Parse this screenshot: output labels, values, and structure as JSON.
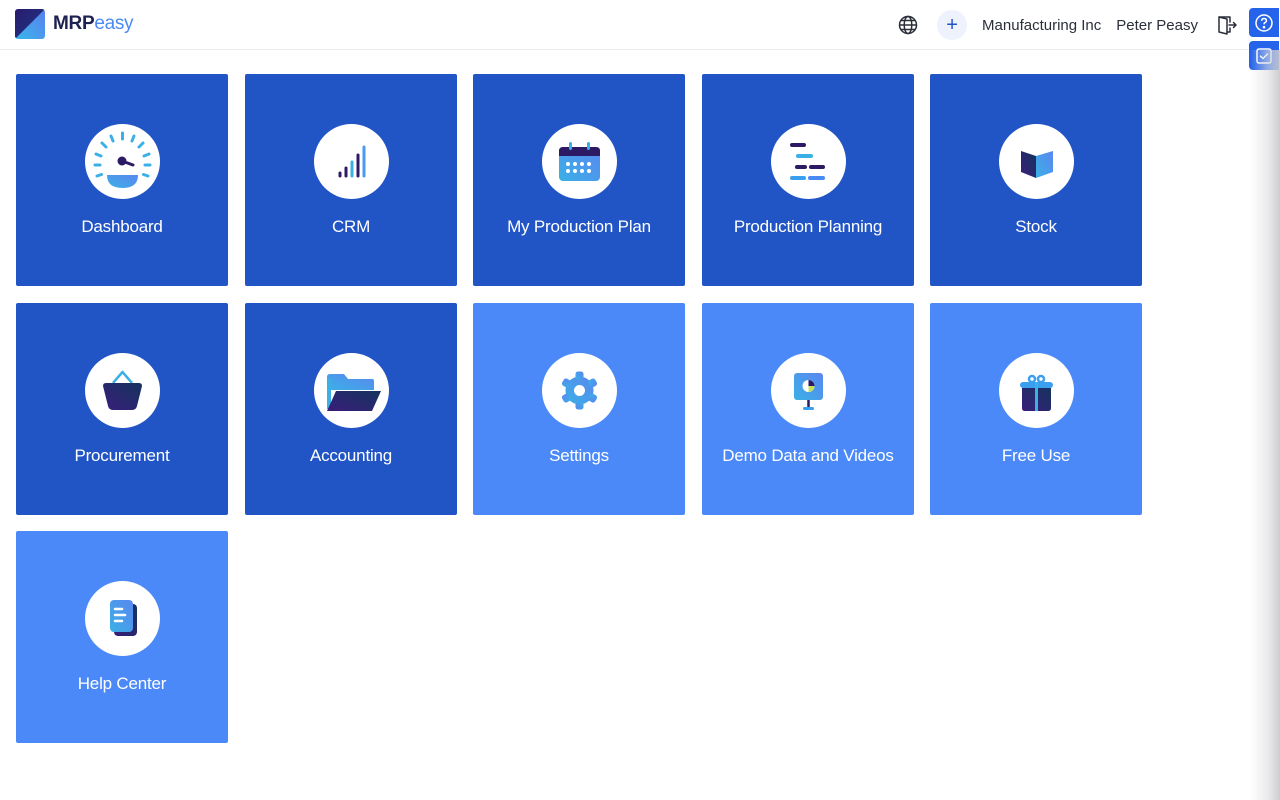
{
  "header": {
    "logo": {
      "brand_bold": "MRP",
      "brand_light": "easy"
    },
    "globe_icon": "globe-icon",
    "add_icon": "+",
    "company": "Manufacturing Inc",
    "user": "Peter Peasy",
    "logout_icon": "logout-icon"
  },
  "side_tabs": [
    {
      "name": "help",
      "icon": "question-circle-icon"
    },
    {
      "name": "tasks",
      "icon": "checkbox-icon"
    }
  ],
  "tiles": [
    {
      "label": "Dashboard",
      "icon": "speedometer-icon",
      "style": "dark"
    },
    {
      "label": "CRM",
      "icon": "bar-signal-icon",
      "style": "dark"
    },
    {
      "label": "My Production Plan",
      "icon": "calendar-icon",
      "style": "dark"
    },
    {
      "label": "Production Planning",
      "icon": "gantt-icon",
      "style": "dark"
    },
    {
      "label": "Stock",
      "icon": "box-icon",
      "style": "dark"
    },
    {
      "label": "Procurement",
      "icon": "basket-icon",
      "style": "dark"
    },
    {
      "label": "Accounting",
      "icon": "folder-icon",
      "style": "dark"
    },
    {
      "label": "Settings",
      "icon": "gear-icon",
      "style": "light"
    },
    {
      "label": "Demo Data and Videos",
      "icon": "presentation-icon",
      "style": "light"
    },
    {
      "label": "Free Use",
      "icon": "gift-icon",
      "style": "light"
    },
    {
      "label": "Help Center",
      "icon": "document-icon",
      "style": "light"
    }
  ],
  "colors": {
    "tile_dark": "#2155c6",
    "tile_light": "#4a89f7",
    "accent": "#2563eb",
    "navy": "#1e2250"
  }
}
